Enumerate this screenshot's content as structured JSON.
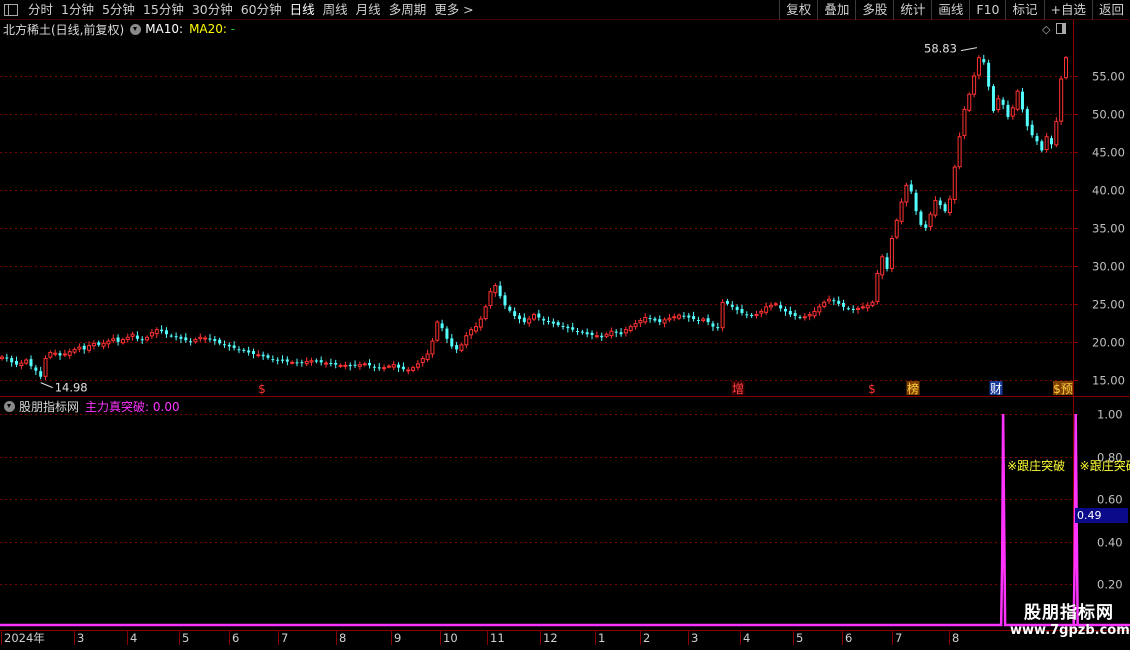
{
  "toolbar": {
    "items": [
      "分时",
      "1分钟",
      "5分钟",
      "15分钟",
      "30分钟",
      "60分钟",
      "日线",
      "周线",
      "月线",
      "多周期",
      "更多 >"
    ],
    "active_index": 6,
    "right_items": [
      "复权",
      "叠加",
      "多股",
      "统计",
      "画线",
      "F10",
      "标记",
      "+自选",
      "返回"
    ]
  },
  "kline": {
    "title": "北方稀土(日线,前复权)",
    "ma10": "MA10:",
    "ma20_label": "MA20:",
    "ma20_value": " -",
    "max_label": "58.83",
    "min_label": "14.98",
    "colors": {
      "up": "#ff3232",
      "down": "#54ffff",
      "grid": "#7a0000",
      "axis": "#c0c0c0"
    }
  },
  "indicator": {
    "name": "股朋指标网",
    "line_label": "主力真突破: 0.00",
    "current_value": "0.49",
    "signal_text": "※跟庄突破",
    "signal_mark": "※",
    "color": "#ff33ff"
  },
  "event_markers": [
    {
      "text": "$",
      "color": "#ff3030"
    },
    {
      "text": "增",
      "color": "#ff4040",
      "bg": "#3a0000"
    },
    {
      "text": "$",
      "color": "#ff3030"
    },
    {
      "text": "榜",
      "color": "#ffd040",
      "bg": "#804000"
    },
    {
      "text": "财",
      "color": "#ffffff",
      "bg": "#1a3a9a"
    },
    {
      "text": "$预",
      "color": "#ffd040",
      "bg": "#804000"
    }
  ],
  "watermark": {
    "line1": "股朋指标网",
    "line2": "www.7gpzb.com"
  },
  "chart_data": {
    "type": "candlestick",
    "price_ticks": [
      55.0,
      50.0,
      45.0,
      40.0,
      35.0,
      30.0,
      25.0,
      20.0,
      15.0
    ],
    "price_range": [
      13.0,
      60.0
    ],
    "indicator_ticks": [
      1.0,
      0.8,
      0.6,
      0.4,
      0.2
    ],
    "indicator_range": [
      0.0,
      1.0
    ],
    "x_labels": [
      "2024年",
      "3",
      "4",
      "5",
      "6",
      "7",
      "8",
      "9",
      "10",
      "11",
      "12",
      "1",
      "2",
      "3",
      "4",
      "5",
      "6",
      "7",
      "8"
    ],
    "close_series": [
      18.0,
      17.8,
      17.3,
      17.0,
      17.2,
      17.6,
      16.8,
      16.2,
      15.4,
      17.8,
      18.6,
      18.5,
      18.2,
      18.4,
      18.7,
      19.0,
      19.3,
      19.0,
      19.5,
      19.8,
      19.6,
      19.8,
      20.1,
      20.4,
      20.0,
      20.3,
      20.6,
      21.0,
      20.4,
      20.2,
      20.6,
      21.2,
      21.6,
      21.4,
      21.0,
      20.8,
      20.6,
      20.4,
      20.2,
      20.0,
      20.3,
      20.6,
      20.5,
      20.3,
      20.1,
      19.8,
      19.6,
      19.4,
      19.2,
      19.0,
      18.8,
      18.6,
      18.4,
      18.3,
      18.1,
      17.9,
      17.7,
      17.6,
      17.5,
      17.4,
      17.3,
      17.2,
      17.3,
      17.4,
      17.5,
      17.4,
      17.3,
      17.2,
      17.1,
      17.0,
      16.9,
      16.9,
      16.8,
      16.9,
      17.0,
      17.1,
      16.9,
      16.7,
      16.5,
      16.6,
      16.8,
      17.0,
      16.6,
      16.4,
      16.3,
      16.6,
      17.1,
      17.8,
      18.4,
      20.1,
      22.6,
      21.8,
      20.4,
      19.4,
      19.0,
      19.6,
      20.8,
      21.6,
      22.0,
      23.0,
      24.6,
      26.6,
      27.4,
      26.0,
      24.8,
      24.1,
      23.4,
      23.0,
      22.6,
      23.0,
      23.6,
      23.2,
      22.8,
      22.6,
      22.4,
      22.2,
      22.0,
      21.8,
      21.6,
      21.4,
      21.2,
      21.0,
      20.9,
      20.8,
      20.6,
      21.0,
      21.4,
      21.2,
      21.0,
      21.6,
      22.0,
      22.4,
      22.8,
      23.2,
      23.0,
      22.8,
      22.6,
      22.9,
      23.1,
      23.3,
      23.5,
      23.4,
      23.2,
      23.0,
      22.8,
      23.0,
      22.6,
      22.0,
      21.8,
      25.2,
      25.0,
      24.6,
      24.2,
      23.8,
      23.6,
      23.4,
      23.6,
      24.0,
      24.6,
      24.8,
      25.0,
      24.4,
      24.0,
      23.6,
      23.4,
      23.2,
      23.3,
      23.6,
      24.0,
      24.6,
      25.2,
      25.6,
      25.4,
      25.0,
      24.6,
      24.4,
      24.2,
      24.4,
      24.6,
      24.8,
      25.2,
      29.0,
      31.2,
      29.6,
      33.6,
      36.0,
      38.4,
      40.6,
      39.8,
      37.2,
      35.4,
      35.0,
      36.8,
      38.6,
      38.0,
      37.2,
      38.8,
      43.0,
      47.0,
      50.6,
      52.6,
      55.0,
      57.4,
      56.8,
      53.6,
      50.4,
      52.0,
      51.2,
      49.6,
      50.8,
      53.0,
      50.6,
      48.4,
      47.2,
      46.4,
      45.2,
      47.0,
      46.0,
      49.0,
      54.6,
      57.4
    ],
    "indicator_spikes_at_index": [
      207,
      222,
      239
    ]
  }
}
